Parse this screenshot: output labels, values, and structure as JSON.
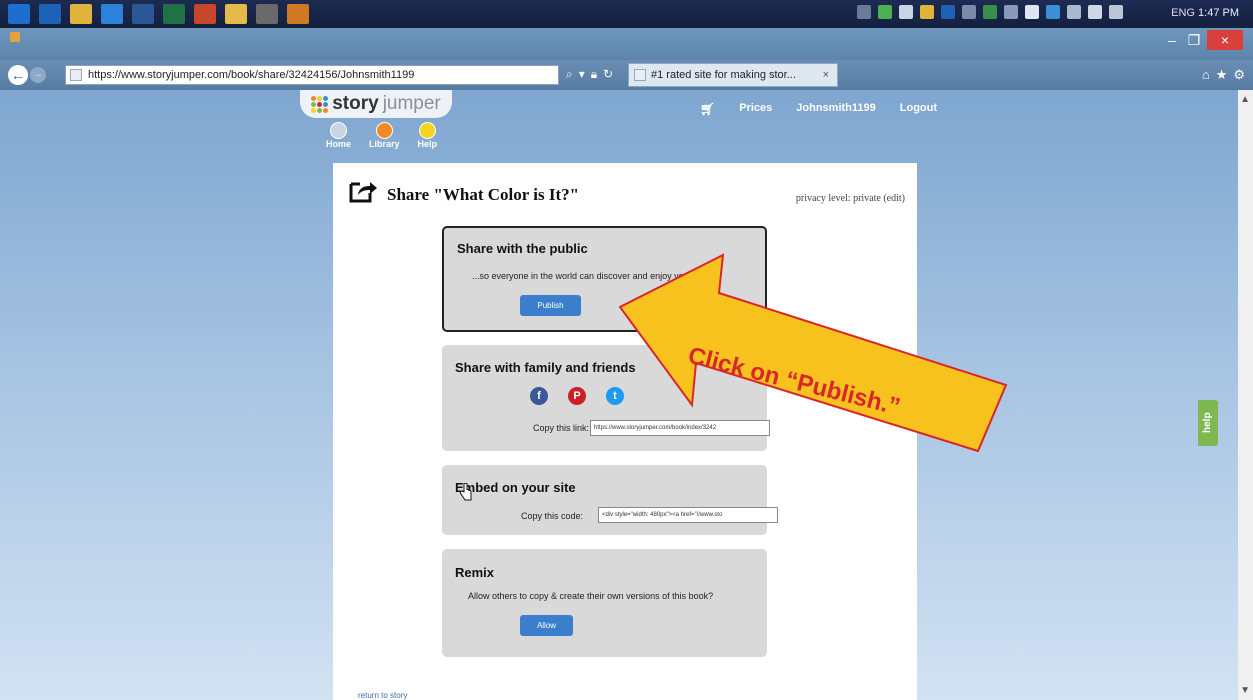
{
  "taskbar": {
    "icons": [
      {
        "name": "windows-start-icon",
        "color": "#1d6fcf"
      },
      {
        "name": "outlook-icon",
        "color": "#1e62b8",
        "label": "O⊠"
      },
      {
        "name": "chrome-icon",
        "color": "#e0b43a"
      },
      {
        "name": "internet-explorer-icon",
        "color": "#2a83d6"
      },
      {
        "name": "word-icon",
        "color": "#2b5797"
      },
      {
        "name": "excel-icon",
        "color": "#1f7246"
      },
      {
        "name": "powerpoint-icon",
        "color": "#c9452c"
      },
      {
        "name": "file-explorer-icon",
        "color": "#e5b94a"
      },
      {
        "name": "calculator-icon",
        "color": "#6a6a6a"
      },
      {
        "name": "media-player-icon",
        "color": "#d07a26"
      }
    ],
    "lang": "ENG",
    "time": "1:47 PM"
  },
  "browser": {
    "url": "https://www.storyjumper.com/book/share/32424156/Johnsmith1199",
    "tab_title": "#1 rated site for making stor...",
    "tab_close": "×",
    "close": "×"
  },
  "site": {
    "logo_story": "story",
    "logo_jumper": "jumper",
    "nav": [
      "Home",
      "Library",
      "Help"
    ],
    "nav_colors": [
      "#c8d5e2",
      "#f08a24",
      "#f5d321"
    ],
    "top_links": [
      "Prices",
      "Johnsmith1199",
      "Logout"
    ],
    "help_tab": "help"
  },
  "share": {
    "title": "Share \"What Color is It?\"",
    "privacy": "privacy level: private (edit)",
    "public_heading": "Share with the public",
    "public_text": "...so everyone in the world can discover and enjoy your story!",
    "publish_btn": "Publish",
    "family_heading": "Share with family and friends",
    "copy_link_label": "Copy this link:",
    "copy_link_value": "https://www.storyjumper.com/book/index/3242",
    "embed_heading": "Embed on your site",
    "copy_code_label": "Copy this code:",
    "copy_code_value": "<div style=\"width: 480px\"><a href=\"//www.sto",
    "remix_heading": "Remix",
    "remix_text": "Allow others to copy & create their own versions of this book?",
    "allow_btn": "Allow",
    "return_link": "return to story"
  },
  "callout": {
    "text": "Click on “Publish.”",
    "fill": "#f7c21d",
    "border": "#d9262a"
  }
}
